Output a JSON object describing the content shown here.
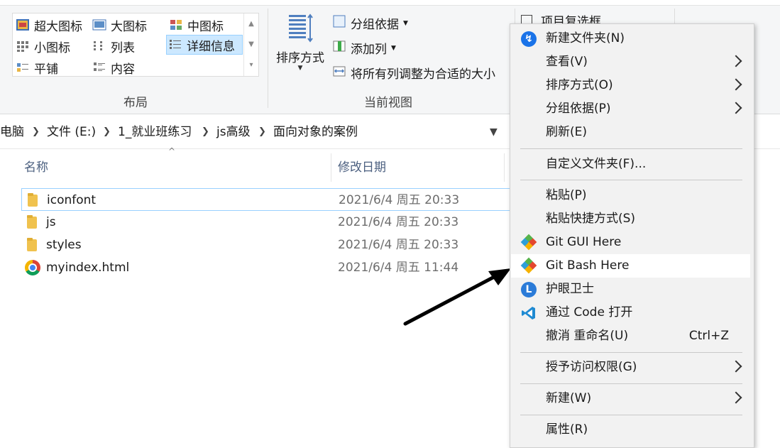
{
  "ribbon": {
    "layout_items": [
      {
        "label": "超大图标",
        "icon": "extra-large-icons-icon"
      },
      {
        "label": "大图标",
        "icon": "large-icons-icon"
      },
      {
        "label": "中图标",
        "icon": "medium-icons-icon"
      },
      {
        "label": "小图标",
        "icon": "small-icons-icon"
      },
      {
        "label": "列表",
        "icon": "list-icon"
      },
      {
        "label": "详细信息",
        "icon": "details-icon",
        "selected": true
      },
      {
        "label": "平铺",
        "icon": "tiles-icon"
      },
      {
        "label": "内容",
        "icon": "content-icon"
      }
    ],
    "layout_group_label": "布局",
    "sort_label": "排序方式",
    "group_by_label": "分组依据",
    "add_column_label": "添加列",
    "fit_columns_label": "将所有列调整为合适的大小",
    "current_view_label": "当前视图",
    "item_checkbox_label": "项目复选框"
  },
  "address": {
    "crumbs": [
      "电脑",
      "文件 (E:)",
      "1_就业班练习",
      "js高级",
      "面向对象的案例"
    ]
  },
  "columns": {
    "name": "名称",
    "modified": "修改日期"
  },
  "files": [
    {
      "name": "iconfont",
      "date": "2021/6/4 周五 20:33",
      "type": "folder"
    },
    {
      "name": "js",
      "date": "2021/6/4 周五 20:33",
      "type": "folder"
    },
    {
      "name": "styles",
      "date": "2021/6/4 周五 20:33",
      "type": "folder"
    },
    {
      "name": "myindex.html",
      "date": "2021/6/4 周五 11:44",
      "type": "chrome-html"
    }
  ],
  "menu": {
    "items": [
      {
        "label": "新建文件夹(N)",
        "icon": "new-folder-icon"
      },
      {
        "label": "查看(V)",
        "submenu": true
      },
      {
        "label": "排序方式(O)",
        "submenu": true
      },
      {
        "label": "分组依据(P)",
        "submenu": true
      },
      {
        "label": "刷新(E)"
      },
      {
        "label": "自定义文件夹(F)..."
      },
      {
        "label": "粘贴(P)"
      },
      {
        "label": "粘贴快捷方式(S)"
      },
      {
        "label": "Git GUI Here",
        "icon": "git-icon"
      },
      {
        "label": "Git Bash Here",
        "icon": "git-icon",
        "hover": true
      },
      {
        "label": "护眼卫士",
        "icon": "eye-guard-icon"
      },
      {
        "label": "通过 Code 打开",
        "icon": "vscode-icon"
      },
      {
        "label": "撤消 重命名(U)",
        "shortcut": "Ctrl+Z"
      },
      {
        "label": "授予访问权限(G)",
        "submenu": true
      },
      {
        "label": "新建(W)",
        "submenu": true
      },
      {
        "label": "属性(R)"
      }
    ]
  },
  "colors": {
    "accent": "#1a73e8",
    "selection": "#cce8ff",
    "menu_bg": "#f2f2f2"
  }
}
